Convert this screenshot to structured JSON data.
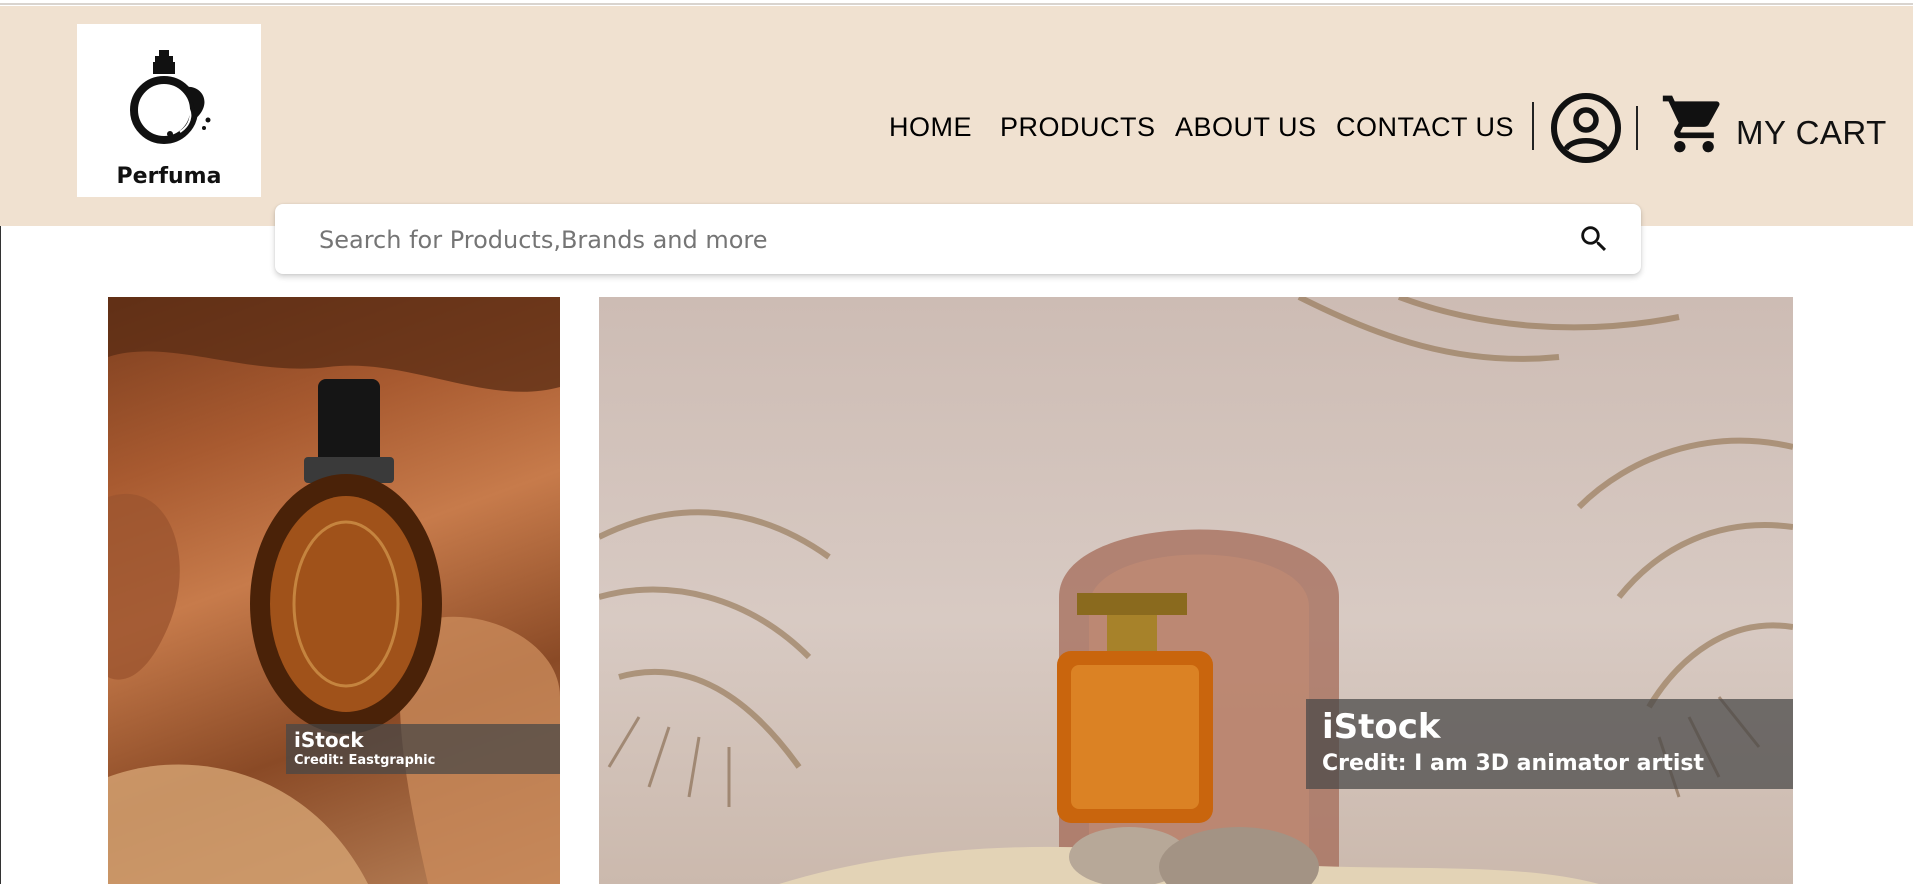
{
  "brand": {
    "name": "Perfuma"
  },
  "nav": {
    "items": [
      {
        "label": "HOME"
      },
      {
        "label": "PRODUCTS"
      },
      {
        "label": "ABOUT US"
      },
      {
        "label": "CONTACT US"
      }
    ]
  },
  "cart": {
    "label": "MY CART"
  },
  "search": {
    "placeholder": "Search for Products,Brands and more"
  },
  "hero": {
    "left": {
      "brand": "iStock",
      "credit": "Credit: Eastgraphic"
    },
    "main": {
      "brand": "iStock",
      "credit": "Credit: I am 3D animator artist"
    }
  },
  "colors": {
    "header_bg": "#f0e1d0",
    "text": "#000000",
    "credit_overlay": "#464646"
  },
  "icons": {
    "account": "account-circle-icon",
    "cart": "shopping-cart-icon",
    "search": "search-icon",
    "logo": "perfume-bottle-icon"
  }
}
